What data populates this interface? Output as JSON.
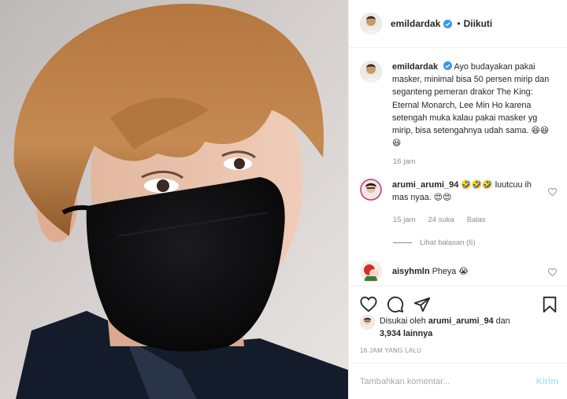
{
  "post": {
    "username": "emildardak",
    "follow_label": "Diikuti",
    "separator": "•",
    "photo_icon": "photo-person-wearing-black-mask"
  },
  "caption": {
    "username": "emildardak",
    "text": "Ayo budayakan pakai masker, minimal bisa 50 persen mirip dan seganteng pemeran drakor The King: Eternal Monarch, Lee Min Ho karena setengah muka kalau pakai masker yg mirip, bisa setengahnya udah sama. 😆😆😆",
    "time": "16 jam"
  },
  "comments": [
    {
      "username": "arumi_arumi_94",
      "text": "🤣🤣🤣 luutcuu ih mas nyaa. 😍😍",
      "time": "15 jam",
      "likes": "24 suka",
      "reply_label": "Balas",
      "view_replies": "Lihat balasan (6)"
    },
    {
      "username": "aisyhmln",
      "text": "Pheya 😭"
    }
  ],
  "actions": {
    "like_icon": "heart-icon",
    "comment_icon": "comment-icon",
    "share_icon": "share-icon",
    "save_icon": "bookmark-icon"
  },
  "likes": {
    "prefix": "Disukai oleh",
    "user": "arumi_arumi_94",
    "joiner": "dan",
    "others": "3,934 lainnya"
  },
  "timeago": "16 JAM YANG LALU",
  "add_comment": {
    "placeholder": "Tambahkan komentar...",
    "send_label": "Kirim"
  },
  "colors": {
    "accent_disabled": "#b2dffc",
    "verified": "#3897f0",
    "muted": "#8e8e8e",
    "border": "#efefef"
  }
}
